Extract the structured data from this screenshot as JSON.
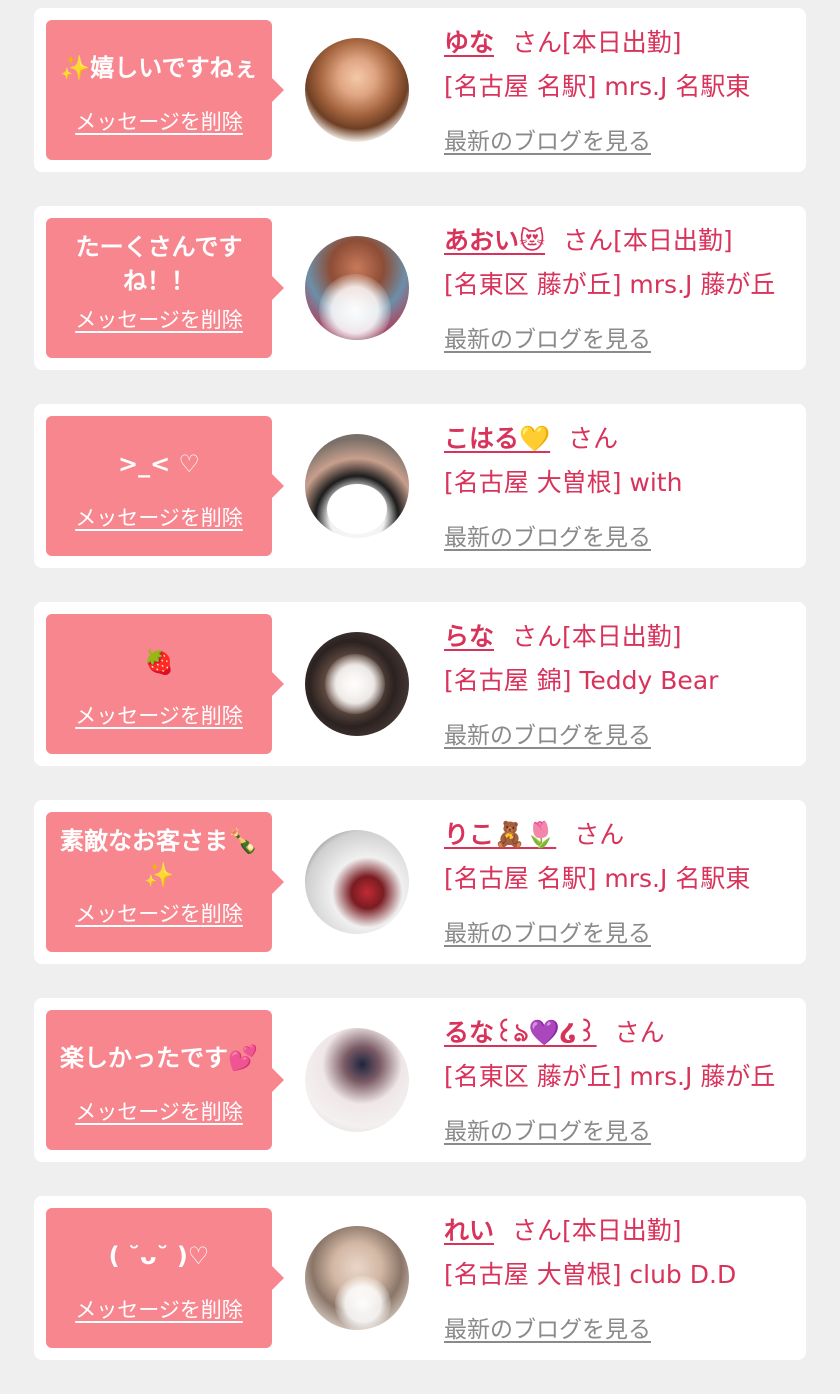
{
  "common": {
    "delete_label": "メッセージを削除",
    "blog_label": "最新のブログを見る",
    "san": "さん"
  },
  "items": [
    {
      "message": "✨嬉しいですねぇ",
      "name": "ゆな",
      "attendance": "[本日出勤]",
      "store": "[名古屋 名駅] mrs.J 名駅東"
    },
    {
      "message": "たーくさんですね！！",
      "name": "あおい😻",
      "attendance": "[本日出勤]",
      "store": "[名東区 藤が丘] mrs.J 藤が丘"
    },
    {
      "message": ">_< ♡",
      "name": "こはる💛",
      "attendance": "",
      "store": "[名古屋 大曽根] with"
    },
    {
      "message": "🍓",
      "name": "らな",
      "attendance": "[本日出勤]",
      "store": "[名古屋 錦] Teddy Bear"
    },
    {
      "message": "素敵なお客さま🍾✨",
      "name": "りこ🧸🌷",
      "attendance": "",
      "store": "[名古屋 名駅] mrs.J 名駅東"
    },
    {
      "message": "楽しかったです💕",
      "name": "るな꒰ঌ💜໒꒱",
      "attendance": "",
      "store": "[名東区 藤が丘] mrs.J 藤が丘"
    },
    {
      "message": "( ˘ᴗ˘ )♡",
      "name": "れい",
      "attendance": "[本日出勤]",
      "store": "[名古屋 大曽根] club D.D"
    }
  ],
  "colors": {
    "bubble": "#f7868f",
    "accent": "#d8335b",
    "link_gray": "#8a8a8a",
    "page_bg": "#efefef"
  }
}
